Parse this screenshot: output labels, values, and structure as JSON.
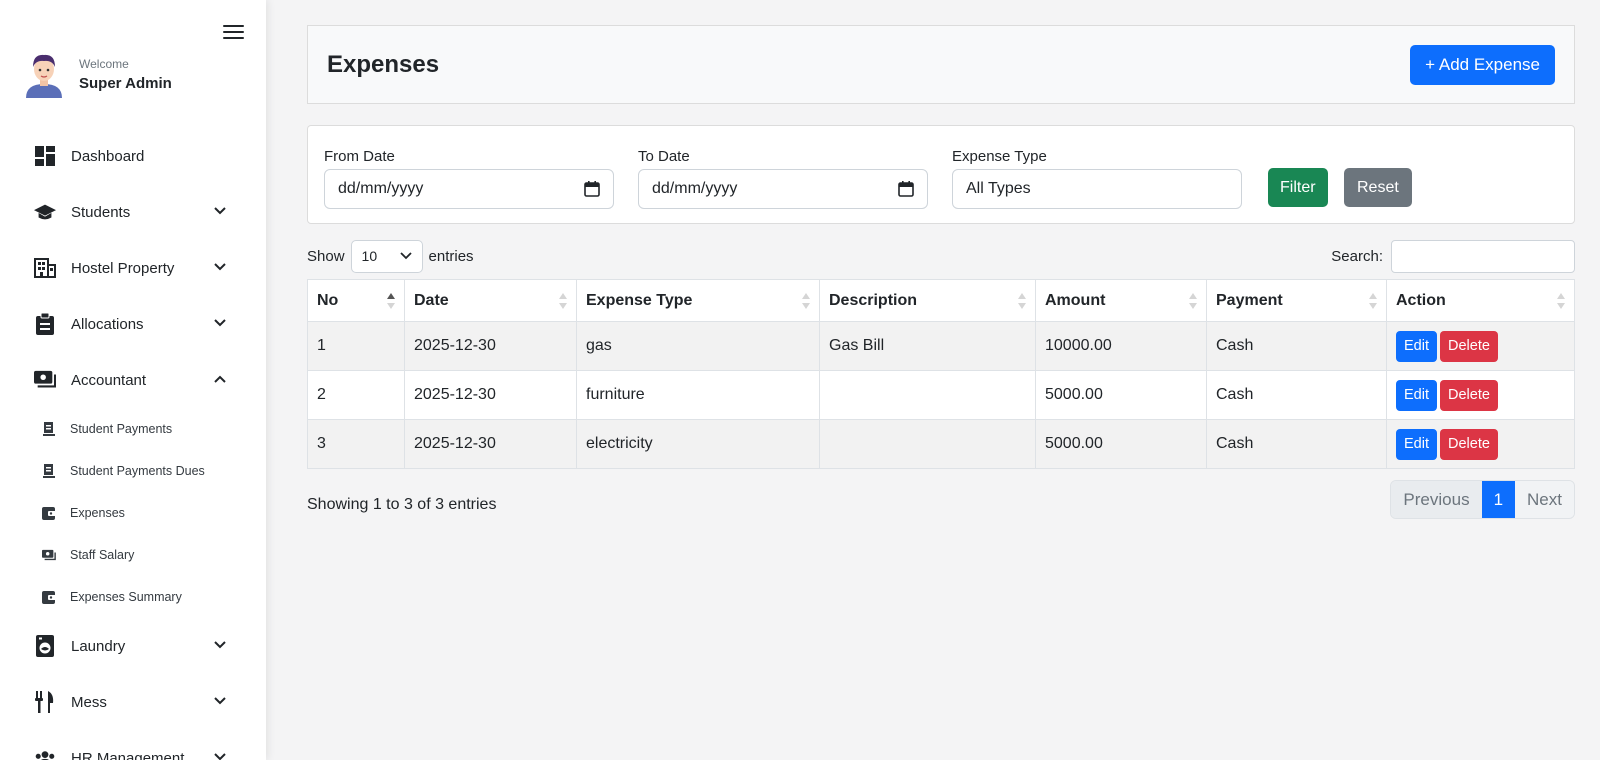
{
  "sidebar": {
    "welcome": "Welcome",
    "user_name": "Super Admin",
    "items": [
      {
        "label": "Dashboard",
        "icon": "dashboard-icon"
      },
      {
        "label": "Students",
        "icon": "graduation-cap-icon"
      },
      {
        "label": "Hostel Property",
        "icon": "building-icon"
      },
      {
        "label": "Allocations",
        "icon": "clipboard-icon"
      },
      {
        "label": "Accountant",
        "icon": "money-icon"
      },
      {
        "label": "Laundry",
        "icon": "washing-machine-icon"
      },
      {
        "label": "Mess",
        "icon": "utensils-icon"
      },
      {
        "label": "HR Management",
        "icon": "users-icon"
      }
    ],
    "sub_items": [
      {
        "label": "Student Payments",
        "icon": "receipt-icon"
      },
      {
        "label": "Student Payments Dues",
        "icon": "receipt-icon"
      },
      {
        "label": "Expenses",
        "icon": "wallet-icon"
      },
      {
        "label": "Staff Salary",
        "icon": "money-icon"
      },
      {
        "label": "Expenses Summary",
        "icon": "wallet-icon"
      }
    ]
  },
  "header": {
    "title": "Expenses",
    "add_button": "+ Add Expense"
  },
  "filters": {
    "from_label": "From Date",
    "from_value": "dd/mm/yyyy",
    "to_label": "To Date",
    "to_value": "dd/mm/yyyy",
    "type_label": "Expense Type",
    "type_value": "All Types",
    "filter_button": "Filter",
    "reset_button": "Reset"
  },
  "table_controls": {
    "show": "Show",
    "entries_count": "10",
    "entries": "entries",
    "search_label": "Search:"
  },
  "table": {
    "columns": [
      "No",
      "Date",
      "Expense Type",
      "Description",
      "Amount",
      "Payment",
      "Action"
    ],
    "rows": [
      {
        "no": "1",
        "date": "2025-12-30",
        "type": "gas",
        "description": "Gas Bill",
        "amount": "10000.00",
        "payment": "Cash"
      },
      {
        "no": "2",
        "date": "2025-12-30",
        "type": "furniture",
        "description": "",
        "amount": "5000.00",
        "payment": "Cash"
      },
      {
        "no": "3",
        "date": "2025-12-30",
        "type": "electricity",
        "description": "",
        "amount": "5000.00",
        "payment": "Cash"
      }
    ],
    "edit_label": "Edit",
    "delete_label": "Delete"
  },
  "footer": {
    "info": "Showing 1 to 3 of 3 entries",
    "previous": "Previous",
    "page": "1",
    "next": "Next"
  },
  "colors": {
    "primary": "#0d6efd",
    "success": "#198754",
    "secondary": "#6c757d",
    "danger": "#dc3545"
  }
}
